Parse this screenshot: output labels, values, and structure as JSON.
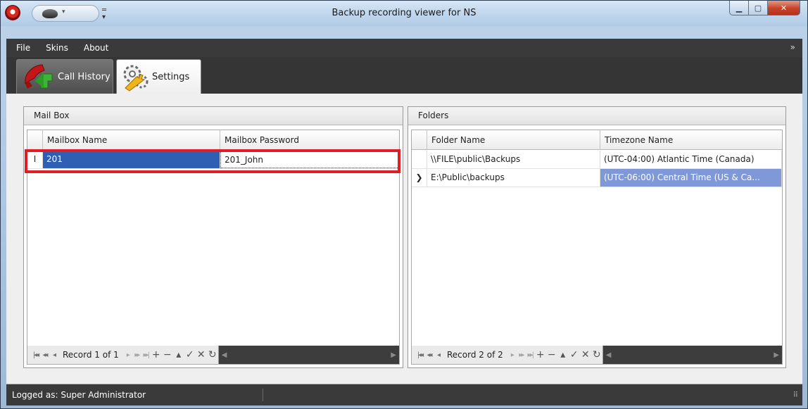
{
  "window": {
    "title": "Backup recording viewer for NS"
  },
  "menu": {
    "items": [
      "File",
      "Skins",
      "About"
    ]
  },
  "tabs": [
    {
      "label": "Call History",
      "icon": "phone-call-icon",
      "active": true
    },
    {
      "label": "Settings",
      "icon": "gears-wrench-icon",
      "active": false
    }
  ],
  "mailbox_panel": {
    "title": "Mail Box",
    "columns": [
      "Mailbox Name",
      "Mailbox Password"
    ],
    "rows": [
      {
        "name": "201",
        "password": "201_John"
      }
    ],
    "navigator": {
      "record_text": "Record 1 of 1"
    }
  },
  "folders_panel": {
    "title": "Folders",
    "columns": [
      "Folder Name",
      "Timezone Name"
    ],
    "rows": [
      {
        "folder": "\\\\FILE\\public\\Backups",
        "timezone": "(UTC-04:00) Atlantic Time (Canada)"
      },
      {
        "folder": "E:\\Public\\backups",
        "timezone": "(UTC-06:00) Central Time (US & Ca..."
      }
    ],
    "navigator": {
      "record_text": "Record 2 of 2"
    }
  },
  "status": {
    "text": "Logged as: Super Administrator"
  },
  "colors": {
    "highlight": "#e11e26",
    "selection": "#2f5fb3",
    "soft_selection": "#7f99d8",
    "chrome": "#3a3a3a"
  }
}
